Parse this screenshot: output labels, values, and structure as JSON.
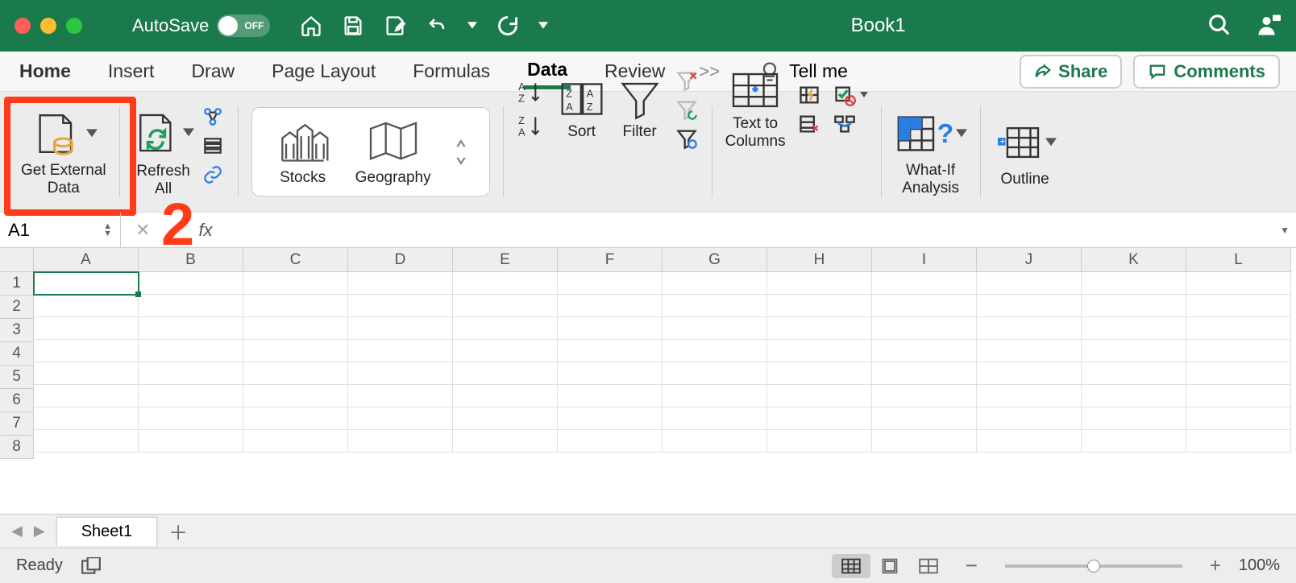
{
  "titlebar": {
    "autosave_label": "AutoSave",
    "autosave_state": "OFF",
    "title": "Book1"
  },
  "tabs": {
    "items": [
      "Home",
      "Insert",
      "Draw",
      "Page Layout",
      "Formulas",
      "Data",
      "Review"
    ],
    "active": "Data",
    "more": ">>",
    "tell_me": "Tell me",
    "share": "Share",
    "comments": "Comments"
  },
  "ribbon": {
    "get_external_data": "Get External\nData",
    "refresh_all": "Refresh\nAll",
    "stocks": "Stocks",
    "geography": "Geography",
    "sort": "Sort",
    "filter": "Filter",
    "text_to_columns": "Text to\nColumns",
    "what_if": "What-If\nAnalysis",
    "outline": "Outline"
  },
  "formulabar": {
    "namebox": "A1",
    "fx": "fx",
    "value": ""
  },
  "grid": {
    "columns": [
      "A",
      "B",
      "C",
      "D",
      "E",
      "F",
      "G",
      "H",
      "I",
      "J",
      "K",
      "L"
    ],
    "rows": [
      1,
      2,
      3,
      4,
      5,
      6,
      7,
      8
    ],
    "selected": "A1"
  },
  "sheets": {
    "active": "Sheet1"
  },
  "status": {
    "ready": "Ready",
    "zoom": "100%"
  },
  "annotation": {
    "number": "2"
  }
}
